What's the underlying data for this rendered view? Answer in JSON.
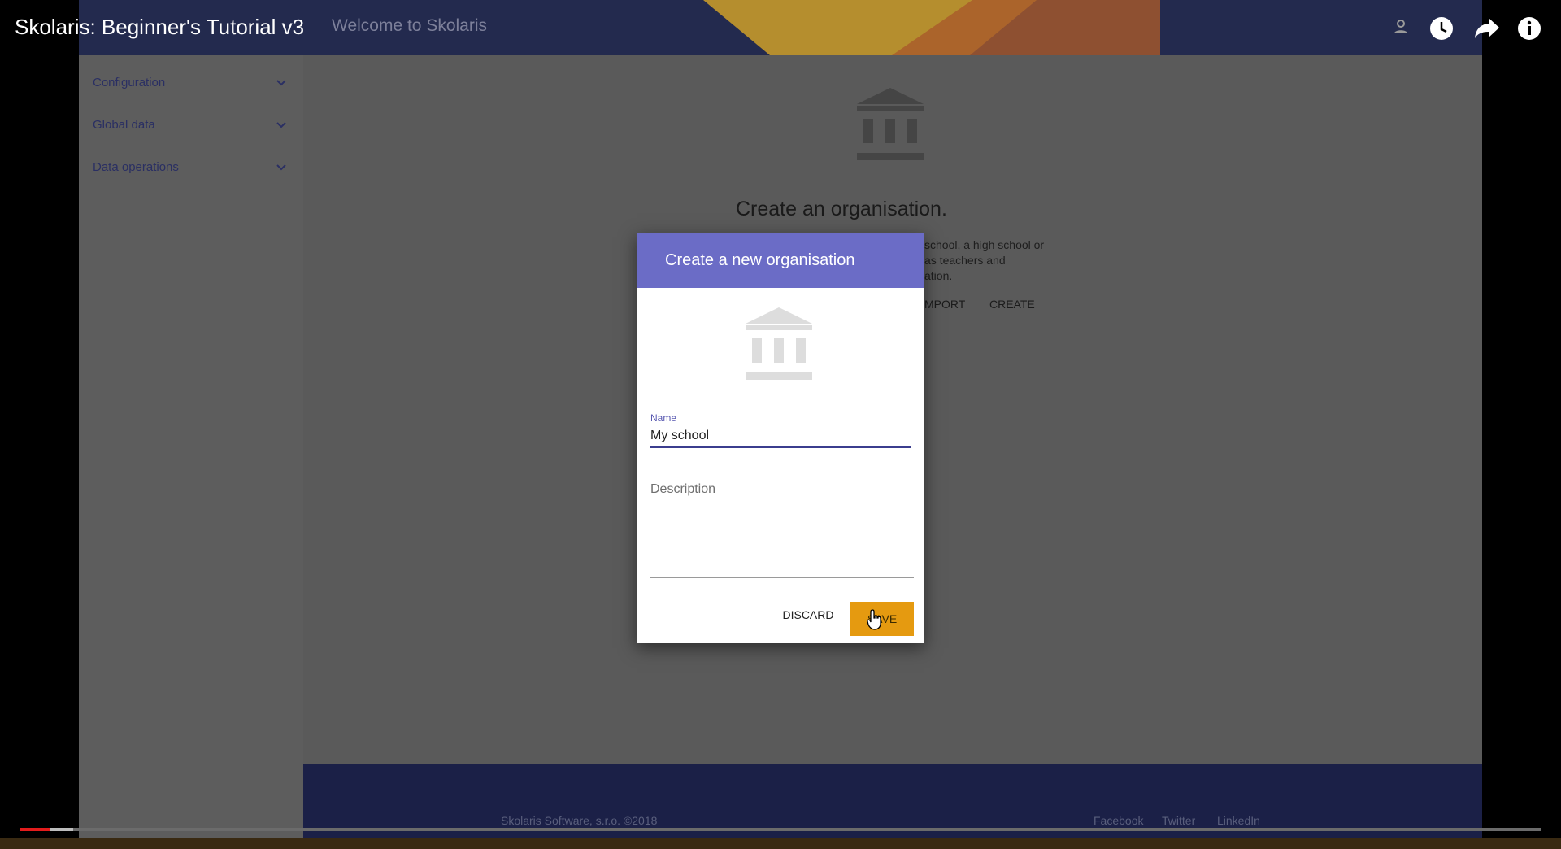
{
  "player": {
    "video_title": "Skolaris: Beginner's Tutorial v3",
    "progress": {
      "played_fraction": 0.02,
      "buffered_fraction": 0.035
    },
    "icons": [
      "account-icon",
      "watch-later-icon",
      "share-icon",
      "info-icon"
    ]
  },
  "app": {
    "header_title": "Welcome to Skolaris",
    "sidebar": {
      "items": [
        {
          "label": "Configuration"
        },
        {
          "label": "Global data"
        },
        {
          "label": "Data operations"
        }
      ]
    },
    "main": {
      "heading": "Create an organisation.",
      "description_lines": [
        "school, a high school or",
        "as teachers and",
        "ation."
      ],
      "actions": {
        "import": "MPORT",
        "create": "CREATE"
      }
    },
    "footer": {
      "copyright": "Skolaris Software, s.r.o. ©2018",
      "links": [
        "Facebook",
        "Twitter",
        "LinkedIn"
      ]
    }
  },
  "modal": {
    "title": "Create a new organisation",
    "name_label": "Name",
    "name_value": "My school",
    "description_label": "Description",
    "description_value": "",
    "discard_label": "DISCARD",
    "save_label": "SAVE"
  },
  "colors": {
    "modal_header": "#6b6cc6",
    "save_button": "#e59a10",
    "app_header": "#232a4e",
    "footer": "#1b2047",
    "progress_played": "#e31c1c"
  }
}
